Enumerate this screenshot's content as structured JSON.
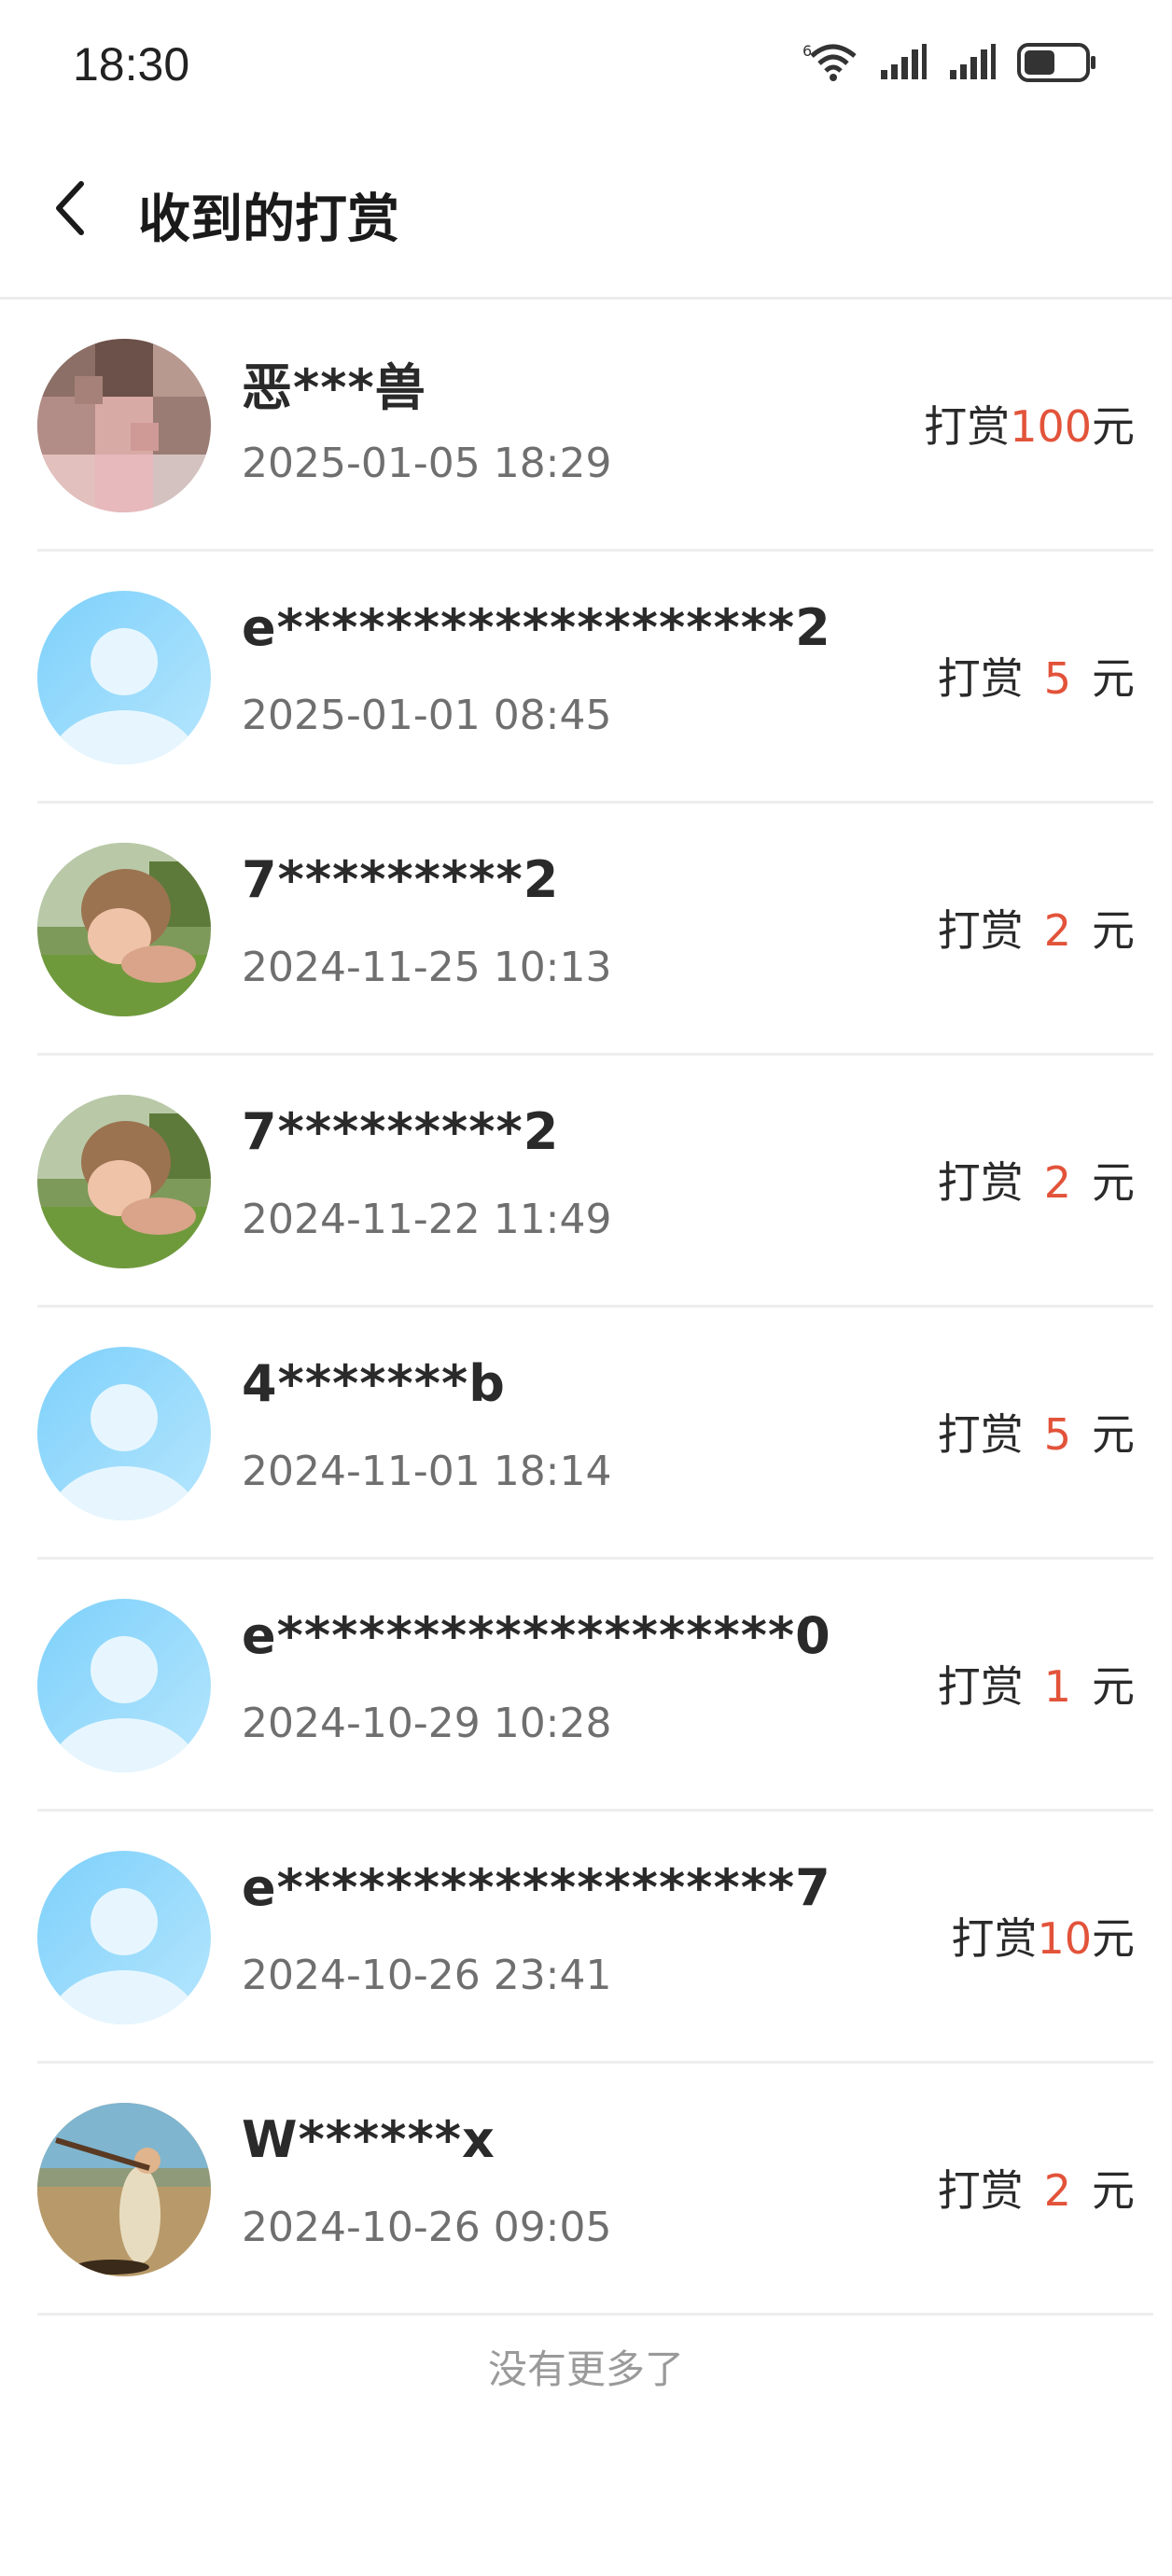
{
  "status_bar": {
    "time": "18:30",
    "icons": [
      "wifi-6-icon",
      "signal-1-icon",
      "signal-2-icon",
      "battery-icon"
    ]
  },
  "header": {
    "title": "收到的打赏",
    "back_icon": "chevron-left-icon"
  },
  "records": [
    {
      "name": "恶***兽",
      "time": "2025-01-05 18:29",
      "prefix": "打赏",
      "amount": "100",
      "suffix": "元",
      "avatar": "pixelated-photo"
    },
    {
      "name": "e*******************2",
      "time": "2025-01-01 08:45",
      "prefix": "打赏",
      "amount": "5",
      "suffix": "元",
      "avatar": "default-avatar"
    },
    {
      "name": "7*********2",
      "time": "2024-11-25 10:13",
      "prefix": "打赏",
      "amount": "2",
      "suffix": "元",
      "avatar": "photo-person-grass"
    },
    {
      "name": "7*********2",
      "time": "2024-11-22 11:49",
      "prefix": "打赏",
      "amount": "2",
      "suffix": "元",
      "avatar": "photo-person-grass"
    },
    {
      "name": "4*******b",
      "time": "2024-11-01 18:14",
      "prefix": "打赏",
      "amount": "5",
      "suffix": "元",
      "avatar": "default-avatar"
    },
    {
      "name": "e*******************0",
      "time": "2024-10-29 10:28",
      "prefix": "打赏",
      "amount": "1",
      "suffix": "元",
      "avatar": "default-avatar"
    },
    {
      "name": "e*******************7",
      "time": "2024-10-26 23:41",
      "prefix": "打赏",
      "amount": "10",
      "suffix": "元",
      "avatar": "default-avatar"
    },
    {
      "name": "W******x",
      "time": "2024-10-26 09:05",
      "prefix": "打赏",
      "amount": "2",
      "suffix": "元",
      "avatar": "photo-person-rifle"
    }
  ],
  "footer": {
    "no_more_text": "没有更多了"
  },
  "colors": {
    "amount": "#e2533a",
    "default_avatar": "#8fd8fb"
  }
}
